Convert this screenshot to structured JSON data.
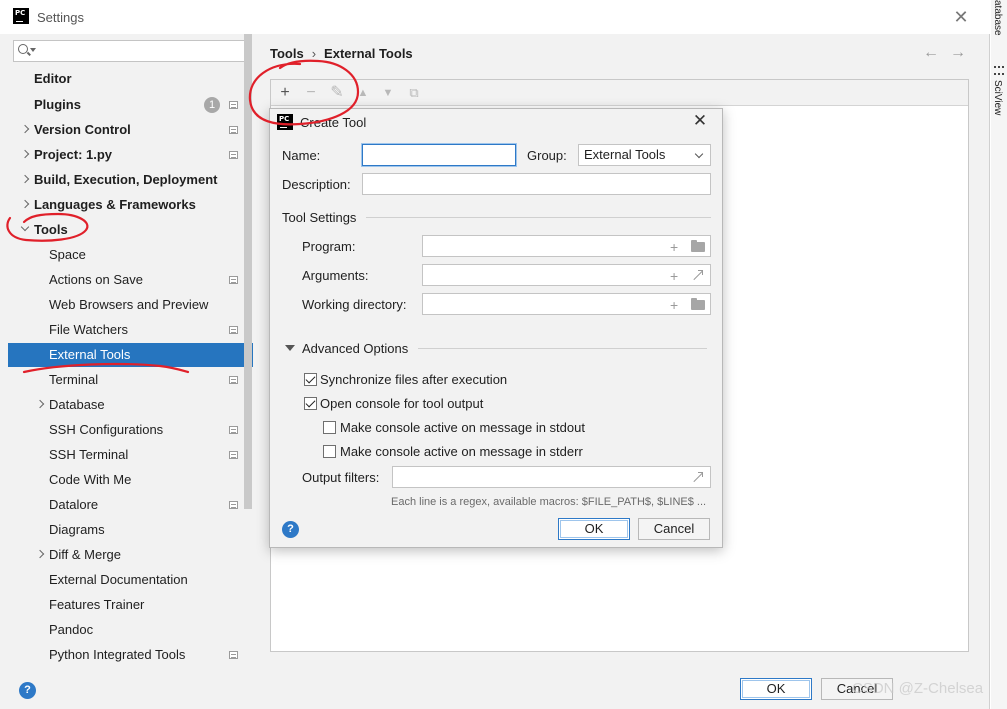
{
  "window": {
    "title": "Settings",
    "close_glyph": "✕"
  },
  "side_strip": {
    "database_label": "atabase",
    "sciview_label": "SciView"
  },
  "sidebar": {
    "search_placeholder": "",
    "items": [
      {
        "label": "Editor"
      },
      {
        "label": "Plugins",
        "badge": "1"
      },
      {
        "label": "Version Control"
      },
      {
        "label": "Project: 1.py"
      },
      {
        "label": "Build, Execution, Deployment"
      },
      {
        "label": "Languages & Frameworks"
      },
      {
        "label": "Tools"
      },
      {
        "label": "Space"
      },
      {
        "label": "Actions on Save"
      },
      {
        "label": "Web Browsers and Preview"
      },
      {
        "label": "File Watchers"
      },
      {
        "label": "External Tools"
      },
      {
        "label": "Terminal"
      },
      {
        "label": "Database"
      },
      {
        "label": "SSH Configurations"
      },
      {
        "label": "SSH Terminal"
      },
      {
        "label": "Code With Me"
      },
      {
        "label": "Datalore"
      },
      {
        "label": "Diagrams"
      },
      {
        "label": "Diff & Merge"
      },
      {
        "label": "External Documentation"
      },
      {
        "label": "Features Trainer"
      },
      {
        "label": "Pandoc"
      },
      {
        "label": "Python Integrated Tools"
      }
    ]
  },
  "content": {
    "breadcrumb": [
      "Tools",
      "External Tools"
    ],
    "breadcrumb_sep": "›",
    "nav_back": "←",
    "nav_forward": "→",
    "toolbar": {
      "add": "+",
      "remove": "−",
      "edit": "✎",
      "up": "▲",
      "down": "▼",
      "copy": "⧉"
    }
  },
  "footer": {
    "help": "?",
    "ok": "OK",
    "cancel": "Cancel",
    "watermark": "CSDN @Z-Chelsea"
  },
  "dialog": {
    "title": "Create Tool",
    "close_glyph": "✕",
    "name_label": "Name:",
    "name_value": "",
    "group_label": "Group:",
    "group_value": "External Tools",
    "description_label": "Description:",
    "description_value": "",
    "tool_settings_label": "Tool Settings",
    "program_label": "Program:",
    "program_value": "",
    "arguments_label": "Arguments:",
    "arguments_value": "",
    "working_dir_label": "Working directory:",
    "working_dir_value": "",
    "advanced_label": "Advanced Options",
    "sync_label": "Synchronize files after execution",
    "sync_checked": true,
    "open_console_label": "Open console for tool output",
    "open_console_checked": true,
    "stdout_label": "Make console active on message in stdout",
    "stdout_checked": false,
    "stderr_label": "Make console active on message in stderr",
    "stderr_checked": false,
    "output_filters_label": "Output filters:",
    "output_filters_value": "",
    "hint": "Each line is a regex, available macros: $FILE_PATH$, $LINE$ ...",
    "help": "?",
    "ok": "OK",
    "cancel": "Cancel"
  },
  "colors": {
    "accent": "#2675bf",
    "annotation": "#e0202a"
  }
}
